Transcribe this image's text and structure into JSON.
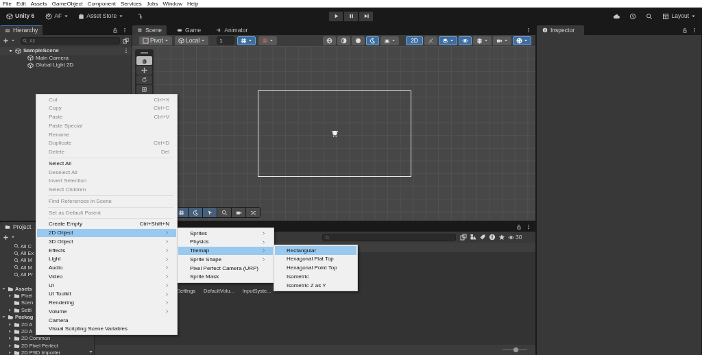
{
  "menu_bar": [
    "File",
    "Edit",
    "Assets",
    "GameObject",
    "Component",
    "Services",
    "Jobs",
    "Window",
    "Help"
  ],
  "toolbar": {
    "product": "Unity 6",
    "account": "AF",
    "store": "Asset Store",
    "layout": "Layout"
  },
  "hierarchy": {
    "title": "Hierarchy",
    "search": {
      "placeholder": "All"
    },
    "scene": {
      "label": "SampleScene",
      "expanded": true,
      "children": [
        {
          "label": "Main Camera"
        },
        {
          "label": "Global Light 2D"
        }
      ]
    }
  },
  "scene_tabs": [
    {
      "label": "Scene",
      "selected": true
    },
    {
      "label": "Game",
      "selected": false
    },
    {
      "label": "Animator",
      "selected": false
    }
  ],
  "scene_toolbar": {
    "pivot": "Pivot",
    "space": "Local",
    "snap_increment": "1",
    "snap_toggles": [
      {
        "kind": "grid",
        "on": true
      },
      {
        "kind": "snap",
        "on": false
      }
    ],
    "view_toggles": [
      {
        "kind": "globe",
        "on": false,
        "dropdown": false
      },
      {
        "kind": "sphere",
        "on": false,
        "dropdown": false
      },
      {
        "kind": "disc",
        "on": false,
        "dropdown": false
      },
      {
        "kind": "moon",
        "on": true,
        "dropdown": false
      },
      {
        "kind": "bug",
        "on": false,
        "dropdown": true
      },
      {
        "kind": "text",
        "label": "2D",
        "on": true,
        "dropdown": false
      },
      {
        "kind": "fx",
        "on": false,
        "dropdown": false
      },
      {
        "kind": "layers",
        "on": true,
        "dropdown": true
      },
      {
        "kind": "eye",
        "on": true,
        "dropdown": false
      },
      {
        "kind": "stack",
        "on": false,
        "dropdown": true
      },
      {
        "kind": "camera",
        "on": false,
        "dropdown": true
      },
      {
        "kind": "gizmo",
        "on": true,
        "dropdown": true
      }
    ]
  },
  "tools": [
    {
      "kind": "hand",
      "selected": true
    },
    {
      "kind": "move",
      "selected": false
    },
    {
      "kind": "rotate",
      "selected": false
    },
    {
      "kind": "rect",
      "selected": false
    }
  ],
  "overlay_tools": [
    {
      "kind": "grid",
      "on": true
    },
    {
      "kind": "moon",
      "on": true
    },
    {
      "kind": "cursor",
      "on": true
    },
    {
      "kind": "search",
      "on": false
    },
    {
      "kind": "camera",
      "on": false
    },
    {
      "kind": "shuffle",
      "on": false
    }
  ],
  "context_menu": {
    "items": [
      {
        "kind": "item",
        "label": "Cut",
        "shortcut": "Ctrl+X",
        "disabled": true,
        "submenu": false,
        "selected": false
      },
      {
        "kind": "item",
        "label": "Copy",
        "shortcut": "Ctrl+C",
        "disabled": true,
        "submenu": false,
        "selected": false
      },
      {
        "kind": "item",
        "label": "Paste",
        "shortcut": "Ctrl+V",
        "disabled": true,
        "submenu": false,
        "selected": false
      },
      {
        "kind": "item",
        "label": "Paste Special",
        "disabled": true,
        "submenu": false,
        "selected": false
      },
      {
        "kind": "item",
        "label": "Rename",
        "disabled": true,
        "submenu": false,
        "selected": false
      },
      {
        "kind": "item",
        "label": "Duplicate",
        "shortcut": "Ctrl+D",
        "disabled": true,
        "submenu": false,
        "selected": false
      },
      {
        "kind": "item",
        "label": "Delete",
        "shortcut": "Del",
        "disabled": true,
        "submenu": false,
        "selected": false
      },
      {
        "kind": "separator"
      },
      {
        "kind": "item",
        "label": "Select All",
        "disabled": false,
        "submenu": false,
        "selected": false
      },
      {
        "kind": "item",
        "label": "Deselect All",
        "disabled": true,
        "submenu": false,
        "selected": false
      },
      {
        "kind": "item",
        "label": "Invert Selection",
        "disabled": true,
        "submenu": false,
        "selected": false
      },
      {
        "kind": "item",
        "label": "Select Children",
        "disabled": true,
        "submenu": false,
        "selected": false
      },
      {
        "kind": "separator"
      },
      {
        "kind": "item",
        "label": "Find References in Scene",
        "disabled": true,
        "submenu": false,
        "selected": false
      },
      {
        "kind": "separator"
      },
      {
        "kind": "item",
        "label": "Set as Default Parent",
        "disabled": true,
        "submenu": false,
        "selected": false
      },
      {
        "kind": "separator"
      },
      {
        "kind": "item",
        "label": "Create Empty",
        "shortcut": "Ctrl+Shift+N",
        "disabled": false,
        "submenu": false,
        "selected": false
      },
      {
        "kind": "item",
        "label": "2D Object",
        "disabled": false,
        "submenu": true,
        "selected": true
      },
      {
        "kind": "item",
        "label": "3D Object",
        "disabled": false,
        "submenu": true,
        "selected": false
      },
      {
        "kind": "item",
        "label": "Effects",
        "disabled": false,
        "submenu": true,
        "selected": false
      },
      {
        "kind": "item",
        "label": "Light",
        "disabled": false,
        "submenu": true,
        "selected": false
      },
      {
        "kind": "item",
        "label": "Audio",
        "disabled": false,
        "submenu": true,
        "selected": false
      },
      {
        "kind": "item",
        "label": "Video",
        "disabled": false,
        "submenu": true,
        "selected": false
      },
      {
        "kind": "item",
        "label": "UI",
        "disabled": false,
        "submenu": true,
        "selected": false
      },
      {
        "kind": "item",
        "label": "UI Toolkit",
        "disabled": false,
        "submenu": true,
        "selected": false
      },
      {
        "kind": "item",
        "label": "Rendering",
        "disabled": false,
        "submenu": true,
        "selected": false
      },
      {
        "kind": "item",
        "label": "Volume",
        "disabled": false,
        "submenu": true,
        "selected": false
      },
      {
        "kind": "item",
        "label": "Camera",
        "disabled": false,
        "submenu": false,
        "selected": false
      },
      {
        "kind": "item",
        "label": "Visual Scripting Scene Variables",
        "disabled": false,
        "submenu": false,
        "selected": false
      }
    ]
  },
  "object_submenu": {
    "items": [
      {
        "kind": "item",
        "label": "Sprites",
        "disabled": false,
        "submenu": true,
        "selected": false
      },
      {
        "kind": "item",
        "label": "Physics",
        "disabled": false,
        "submenu": true,
        "selected": false
      },
      {
        "kind": "item",
        "label": "Tilemap",
        "disabled": false,
        "submenu": true,
        "selected": true
      },
      {
        "kind": "item",
        "label": "Sprite Shape",
        "disabled": false,
        "submenu": true,
        "selected": false
      },
      {
        "kind": "item",
        "label": "Pixel Perfect Camera (URP)",
        "disabled": false,
        "submenu": false,
        "selected": false
      },
      {
        "kind": "item",
        "label": "Sprite Mask",
        "disabled": false,
        "submenu": false,
        "selected": false
      }
    ]
  },
  "tilemap_submenu": {
    "items": [
      {
        "kind": "item",
        "label": "Rectangular",
        "disabled": false,
        "submenu": false,
        "selected": true
      },
      {
        "kind": "item",
        "label": "Hexagonal Flat Top",
        "disabled": false,
        "submenu": false,
        "selected": false
      },
      {
        "kind": "item",
        "label": "Hexagonal Point Top",
        "disabled": false,
        "submenu": false,
        "selected": false
      },
      {
        "kind": "item",
        "label": "Isometric",
        "disabled": false,
        "submenu": false,
        "selected": false
      },
      {
        "kind": "item",
        "label": "Isometric Z as Y",
        "disabled": false,
        "submenu": false,
        "selected": false
      }
    ]
  },
  "project": {
    "title": "Project",
    "favorites": [
      "All C",
      "All Ex",
      "All M",
      "All M",
      "All Pr"
    ],
    "tree": [
      {
        "label": "Assets",
        "expanded": true,
        "children": [
          {
            "label": "Pixel",
            "expanded": false
          },
          {
            "label": "Scen"
          },
          {
            "label": "Setti",
            "expanded": false
          }
        ]
      },
      {
        "label": "Packag",
        "expanded": true,
        "children": [
          {
            "label": "2D A",
            "expanded": false
          },
          {
            "label": "2D A",
            "expanded": false
          },
          {
            "label": "2D Common",
            "expanded": false
          },
          {
            "label": "2D Pixel Perfect",
            "expanded": false
          },
          {
            "label": "2D PSD Importer",
            "expanded": false
          }
        ]
      }
    ],
    "hidden_count": "30",
    "assets": [
      "Settings",
      "DefaultVolu...",
      "InputSyste..."
    ],
    "zoom": {
      "level": 0.55
    }
  },
  "inspector": {
    "title": "Inspector"
  }
}
